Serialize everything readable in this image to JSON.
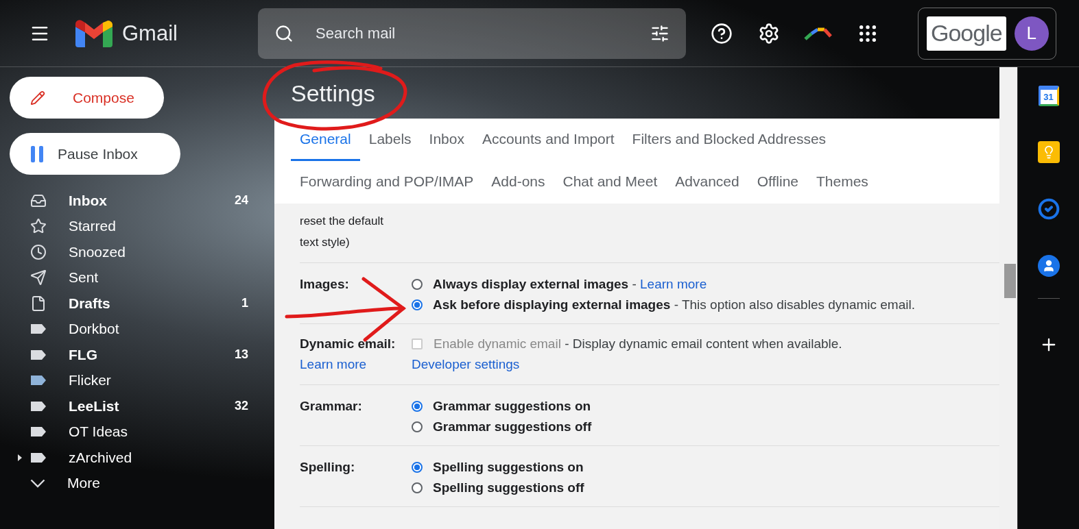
{
  "app": {
    "name": "Gmail"
  },
  "search": {
    "placeholder": "Search mail"
  },
  "account": {
    "brand": "Google",
    "initial": "L"
  },
  "sidebar": {
    "compose": "Compose",
    "pause": "Pause Inbox",
    "items": [
      {
        "kind": "inbox",
        "label": "Inbox",
        "count": "24",
        "unread": true
      },
      {
        "kind": "starred",
        "label": "Starred",
        "unread": false
      },
      {
        "kind": "snoozed",
        "label": "Snoozed",
        "unread": false
      },
      {
        "kind": "sent",
        "label": "Sent",
        "unread": false
      },
      {
        "kind": "drafts",
        "label": "Drafts",
        "count": "1",
        "unread": true
      },
      {
        "kind": "label",
        "label": "Dorkbot",
        "unread": false,
        "color": "#dadce0"
      },
      {
        "kind": "label",
        "label": "FLG",
        "count": "13",
        "unread": true,
        "color": "#dadce0"
      },
      {
        "kind": "label",
        "label": "Flicker",
        "unread": false,
        "color": "#8fb3d9"
      },
      {
        "kind": "label",
        "label": "LeeList",
        "count": "32",
        "unread": true,
        "color": "#dadce0"
      },
      {
        "kind": "label",
        "label": "OT Ideas",
        "unread": false,
        "color": "#dadce0"
      },
      {
        "kind": "label",
        "label": "zArchived",
        "unread": false,
        "color": "#dadce0",
        "expanded": false
      },
      {
        "kind": "more",
        "label": "More",
        "unread": false
      }
    ]
  },
  "page": {
    "title": "Settings"
  },
  "tabs": [
    [
      {
        "label": "General",
        "selected": true
      },
      {
        "label": "Labels",
        "selected": false
      },
      {
        "label": "Inbox",
        "selected": false
      },
      {
        "label": "Accounts and Import",
        "selected": false
      },
      {
        "label": "Filters and Blocked Addresses",
        "selected": false
      }
    ],
    [
      {
        "label": "Forwarding and POP/IMAP",
        "selected": false
      },
      {
        "label": "Add-ons",
        "selected": false
      },
      {
        "label": "Chat and Meet",
        "selected": false
      },
      {
        "label": "Advanced",
        "selected": false
      },
      {
        "label": "Offline",
        "selected": false
      },
      {
        "label": "Themes",
        "selected": false
      }
    ]
  ],
  "settings": [
    {
      "kind": "text",
      "lines": [
        "reset the default",
        "text style)"
      ]
    },
    {
      "kind": "radio",
      "label": "Images:",
      "options": [
        {
          "label": "Always display external images",
          "selected": false,
          "separator": " - ",
          "link": "Learn more"
        },
        {
          "label": "Ask before displaying external images",
          "selected": true,
          "description": " - This option also disables dynamic email."
        }
      ]
    },
    {
      "kind": "checkbox",
      "label": "Dynamic email:",
      "label_link": "Learn more",
      "checkbox": {
        "label": "Enable dynamic email",
        "checked": false,
        "disabled": true,
        "description": " - Display dynamic email content when available."
      },
      "link": "Developer settings"
    },
    {
      "kind": "radio",
      "label": "Grammar:",
      "options": [
        {
          "label": "Grammar suggestions on",
          "selected": true
        },
        {
          "label": "Grammar suggestions off",
          "selected": false
        }
      ]
    },
    {
      "kind": "radio",
      "label": "Spelling:",
      "options": [
        {
          "label": "Spelling suggestions on",
          "selected": true
        },
        {
          "label": "Spelling suggestions off",
          "selected": false
        }
      ]
    }
  ],
  "side_panel": {
    "calendar_day": "31"
  }
}
